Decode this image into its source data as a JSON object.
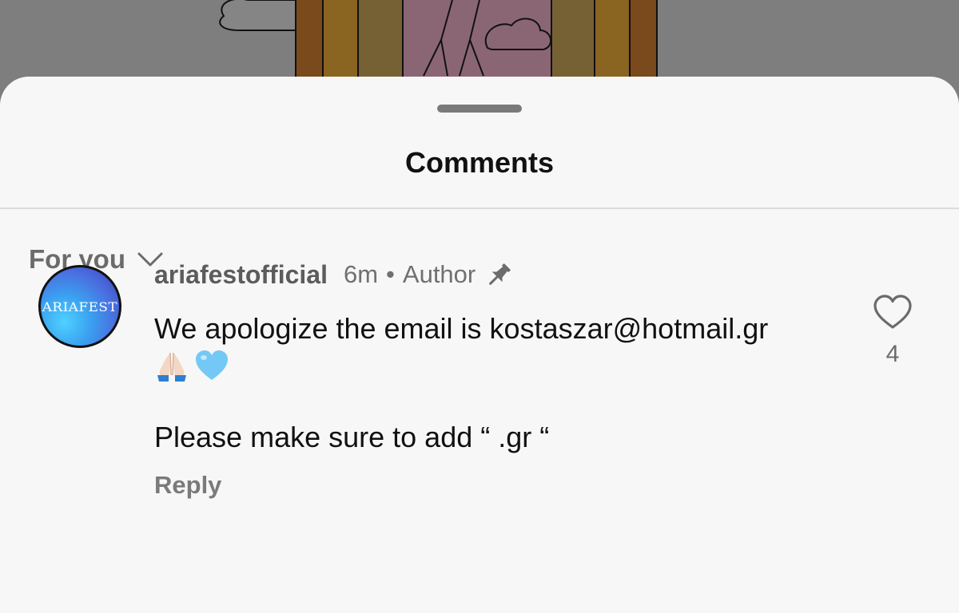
{
  "sheet": {
    "title": "Comments",
    "sort_label": "For you"
  },
  "comment": {
    "avatar_text": "ARIAFEST",
    "username": "ariafestofficial",
    "time": "6m",
    "separator": "•",
    "badge": "Author",
    "text_line1": "We apologize the email is kostaszar@hotmail.gr",
    "emoji_names": [
      "folded-hands-icon",
      "light-blue-heart-icon"
    ],
    "text_line2": "Please make sure to add “ .gr “",
    "reply_label": "Reply",
    "like_count": "4"
  },
  "colors": {
    "sheet_background": "#f7f7f7",
    "dim_overlay": "#7d7d7d",
    "heart_emoji": "#74c8f5"
  }
}
